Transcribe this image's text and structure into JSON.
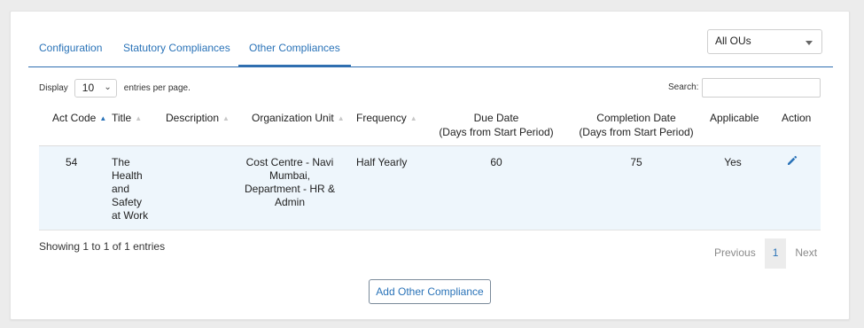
{
  "tabs": [
    {
      "label": "Configuration"
    },
    {
      "label": "Statutory Compliances"
    },
    {
      "label": "Other Compliances"
    }
  ],
  "ou_select": {
    "value": "All OUs"
  },
  "length": {
    "prefix": "Display",
    "value": "10",
    "suffix": "entries per page."
  },
  "search": {
    "label": "Search:",
    "value": ""
  },
  "table": {
    "headers": {
      "act_code": "Act Code",
      "title": "Title",
      "description": "Description",
      "org_unit": "Organization Unit",
      "frequency": "Frequency",
      "due_date_1": "Due Date",
      "due_date_2": "(Days from Start Period)",
      "completion_1": "Completion Date",
      "completion_2": "(Days from Start Period)",
      "applicable": "Applicable",
      "action": "Action"
    },
    "rows": [
      {
        "act_code": "54",
        "title_lines": [
          "The",
          "Health",
          "and",
          "Safety",
          "at Work"
        ],
        "description": "",
        "org_unit_lines": [
          "Cost Centre - Navi",
          "Mumbai,",
          "Department - HR &",
          "Admin"
        ],
        "frequency": "Half Yearly",
        "due_days": "60",
        "completion_days": "75",
        "applicable": "Yes",
        "action_icon": "pencil-icon"
      }
    ]
  },
  "info": "Showing 1 to 1 of 1 entries",
  "pager": {
    "previous": "Previous",
    "current": "1",
    "next": "Next"
  },
  "add_button": "Add Other Compliance",
  "colors": {
    "accent": "#2a73b8",
    "row_highlight": "#eef6fc"
  }
}
